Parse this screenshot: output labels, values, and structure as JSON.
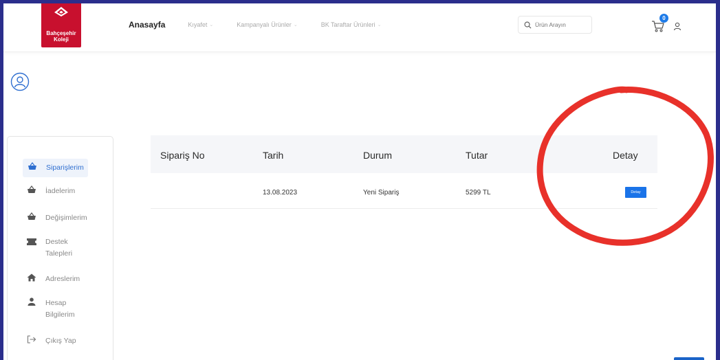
{
  "header": {
    "logo_line1": "Bahçeşehir",
    "logo_line2": "Koleji",
    "nav_home": "Anasayfa",
    "nav_items": [
      "Kıyafet",
      "Kampanyalı Ürünler",
      "BK Taraftar Ürünleri"
    ],
    "search_placeholder": "Ürün Arayın",
    "cart_count": "0"
  },
  "sidebar": {
    "items": [
      {
        "label": "Siparişlerim",
        "icon": "basket-icon",
        "active": true
      },
      {
        "label": "İadelerim",
        "icon": "basket-icon"
      },
      {
        "label": "Değişimlerim",
        "icon": "basket-icon"
      },
      {
        "label": "Destek Talepleri",
        "icon": "ticket-icon"
      },
      {
        "label": "Adreslerim",
        "icon": "home-icon"
      },
      {
        "label": "Hesap Bilgilerim",
        "icon": "user-icon"
      },
      {
        "label": "Çıkış Yap",
        "icon": "logout-icon"
      }
    ]
  },
  "orders": {
    "columns": [
      "Sipariş No",
      "Tarih",
      "Durum",
      "Tutar",
      "Detay"
    ],
    "rows": [
      {
        "order_no": "",
        "date": "13.08.2023",
        "status": "Yeni Sipariş",
        "amount": "5299 TL",
        "detail_label": "Detay"
      }
    ]
  },
  "colors": {
    "accent": "#1a73e8",
    "brand": "#c8102e",
    "annotation": "#e8312a",
    "border": "#2b2e8c"
  }
}
